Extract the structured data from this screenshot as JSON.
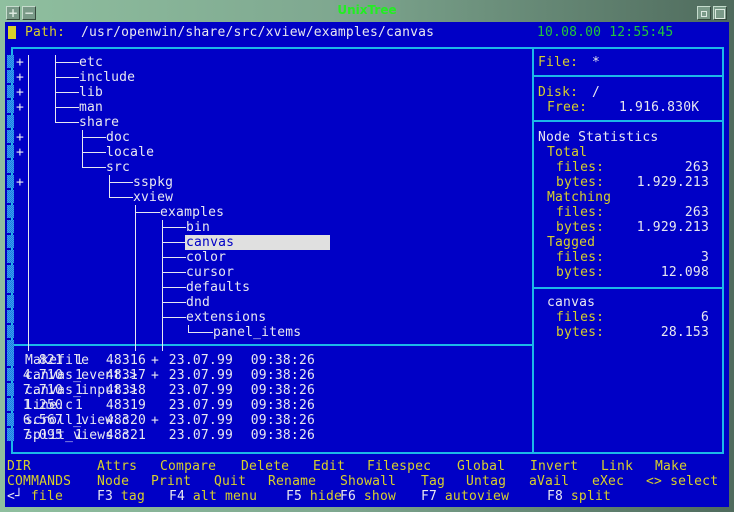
{
  "window": {
    "title": "UnixTree",
    "buttons": [
      "+",
      "−"
    ],
    "right_buttons": [
      "minimize",
      "maximize"
    ]
  },
  "header": {
    "path_label": "Path:",
    "path_value": "/usr/openwin/share/src/xview/examples/canvas",
    "datetime": "10.08.00 12:55:45"
  },
  "tree": {
    "nodes": [
      {
        "name": "etc",
        "expandable": "+"
      },
      {
        "name": "include",
        "expandable": "+"
      },
      {
        "name": "lib",
        "expandable": "+"
      },
      {
        "name": "man",
        "expandable": "+"
      },
      {
        "name": "share",
        "expandable": ""
      },
      {
        "name": "doc",
        "expandable": "+"
      },
      {
        "name": "locale",
        "expandable": "+"
      },
      {
        "name": "src",
        "expandable": ""
      },
      {
        "name": "sspkg",
        "expandable": "+"
      },
      {
        "name": "xview",
        "expandable": ""
      },
      {
        "name": "examples",
        "expandable": ""
      },
      {
        "name": "bin",
        "expandable": ""
      },
      {
        "name": "canvas",
        "expandable": "",
        "selected": true
      },
      {
        "name": "color",
        "expandable": ""
      },
      {
        "name": "cursor",
        "expandable": ""
      },
      {
        "name": "defaults",
        "expandable": ""
      },
      {
        "name": "dnd",
        "expandable": ""
      },
      {
        "name": "extensions",
        "expandable": ""
      },
      {
        "name": "panel_items",
        "expandable": ""
      }
    ]
  },
  "files": {
    "rows": [
      {
        "name": "Makefile",
        "flag": "+",
        "size": "821",
        "links": "1",
        "inode": "48316",
        "date": "23.07.99",
        "time": "09:38:26"
      },
      {
        "name": "canvas_event.>",
        "flag": "+",
        "size": "4.710",
        "links": "1",
        "inode": "48317",
        "date": "23.07.99",
        "time": "09:38:26"
      },
      {
        "name": "canvas_input.>",
        "flag": "",
        "size": "7.710",
        "links": "1",
        "inode": "48318",
        "date": "23.07.99",
        "time": "09:38:26"
      },
      {
        "name": "line.c",
        "flag": "",
        "size": "1.250",
        "links": "1",
        "inode": "48319",
        "date": "23.07.99",
        "time": "09:38:26"
      },
      {
        "name": "scroll_view.c",
        "flag": "+",
        "size": "6.567",
        "links": "1",
        "inode": "48320",
        "date": "23.07.99",
        "time": "09:38:26"
      },
      {
        "name": "split_views.c",
        "flag": "",
        "size": "7.095",
        "links": "1",
        "inode": "48321",
        "date": "23.07.99",
        "time": "09:38:26"
      }
    ]
  },
  "info": {
    "file_label": "File:",
    "file_value": "*",
    "disk_label": "Disk:",
    "disk_value": "/",
    "free_label": "Free:",
    "free_value": "1.916.830K",
    "stats_title": "Node Statistics",
    "total_label": "Total",
    "total_files_label": "files:",
    "total_files": "263",
    "total_bytes_label": "bytes:",
    "total_bytes": "1.929.213",
    "matching_label": "Matching",
    "matching_files_label": "files:",
    "matching_files": "263",
    "matching_bytes_label": "bytes:",
    "matching_bytes": "1.929.213",
    "tagged_label": "Tagged",
    "tagged_files_label": "files:",
    "tagged_files": "3",
    "tagged_bytes_label": "bytes:",
    "tagged_bytes": "12.098",
    "dir_name": "canvas",
    "dir_files_label": "files:",
    "dir_files": "6",
    "dir_bytes_label": "bytes:",
    "dir_bytes": "28.153"
  },
  "menu": {
    "row1_label": "DIR",
    "row1": [
      "Attrs",
      "Compare",
      "Delete",
      "Edit",
      "Filespec",
      "Global",
      "Invert",
      "Link",
      "Make"
    ],
    "row2_label": "COMMANDS",
    "row2": [
      "Node",
      "Print",
      "Quit",
      "Rename",
      "Showall",
      "Tag",
      "Untag",
      "aVail",
      "eXec",
      "<> select"
    ],
    "row3": [
      {
        "key": "<┘",
        "label": "file"
      },
      {
        "key": "F3",
        "label": "tag"
      },
      {
        "key": "F4",
        "label": "alt menu"
      },
      {
        "key": "F5",
        "label": "hide"
      },
      {
        "key": "F6",
        "label": "show"
      },
      {
        "key": "F7",
        "label": "autoview"
      },
      {
        "key": "F8",
        "label": "split"
      }
    ]
  },
  "colors": {
    "background": "#0000c6",
    "border": "#1cb8e8",
    "label": "#d8d02a",
    "value": "#e8e8f0",
    "datetime": "#22c63a",
    "title": "#22ee22",
    "selection": "#e0e0e0"
  }
}
